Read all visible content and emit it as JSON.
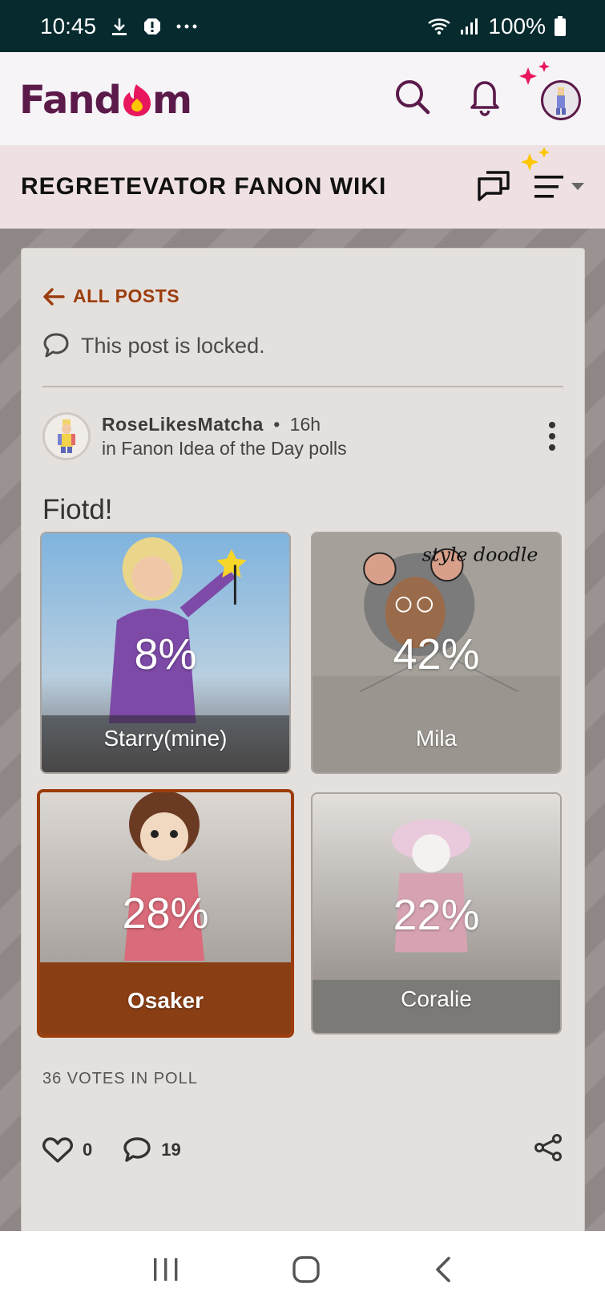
{
  "status_bar": {
    "time": "10:45",
    "icons_left": [
      "download-icon",
      "alert-icon",
      "more-dots-icon"
    ],
    "icons_right": [
      "wifi-icon",
      "signal-icon",
      "battery-icon"
    ],
    "battery": "100%"
  },
  "header": {
    "logo": "Fandom",
    "icons": [
      "search-icon",
      "bell-icon",
      "avatar-icon"
    ]
  },
  "wiki": {
    "title": "REGRETEVATOR FANON WIKI",
    "icons": [
      "discussions-icon",
      "menu-icon"
    ]
  },
  "post": {
    "back_label": "ALL POSTS",
    "locked_text": "This post is locked.",
    "author": "RoseLikesMatcha",
    "separator": "•",
    "time_ago": "16h",
    "category": "in Fanon Idea of the Day polls",
    "title": "Fiotd!",
    "poll": {
      "options": [
        {
          "label": "Starry(mine)",
          "percent": "8%",
          "value": 8,
          "selected": false
        },
        {
          "label": "Mila",
          "percent": "42%",
          "value": 42,
          "selected": false
        },
        {
          "label": "Osaker",
          "percent": "28%",
          "value": 28,
          "selected": true
        },
        {
          "label": "Coralie",
          "percent": "22%",
          "value": 22,
          "selected": false
        }
      ],
      "votes_text": "36 VOTES IN POLL",
      "doodle_text": "style doodle"
    },
    "likes": "0",
    "comments": "19"
  },
  "colors": {
    "accent": "#9c3d0d",
    "brand": "#5b1a4a",
    "status_bar": "#062a2e"
  }
}
